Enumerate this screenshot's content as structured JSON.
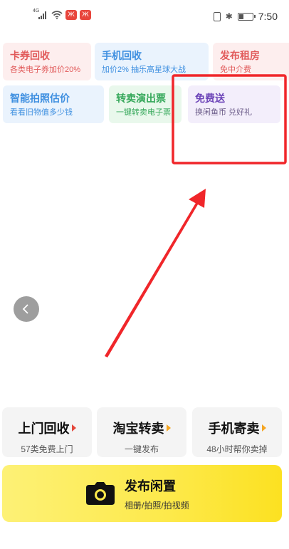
{
  "status_bar": {
    "network_label": "4G",
    "app_badge_1": "Ж",
    "app_badge_2": "Ж",
    "bluetooth_glyph": "✱",
    "time": "7:50"
  },
  "services": [
    {
      "title": "卡券回收",
      "subtitle": "各类电子券加价20%",
      "color": "red"
    },
    {
      "title": "手机回收",
      "subtitle": "加价2% 抽乐高星球大战",
      "color": "blue"
    },
    {
      "title": "发布租房",
      "subtitle": "免中介费",
      "color": "red"
    },
    {
      "title": "智能拍照估价",
      "subtitle": "看看旧物值多少钱",
      "color": "blue"
    },
    {
      "title": "转卖演出票",
      "subtitle": "一键转卖电子票",
      "color": "green"
    },
    {
      "title": "免费送",
      "subtitle": "换闲鱼币 兑好礼",
      "color": "purple"
    }
  ],
  "annotation": {
    "highlight_color": "#f0262a"
  },
  "quick_actions": [
    {
      "title": "上门回收",
      "subtitle": "57类免费上门"
    },
    {
      "title": "淘宝转卖",
      "subtitle": "一键发布"
    },
    {
      "title": "手机寄卖",
      "subtitle": "48小时帮你卖掉"
    }
  ],
  "publish": {
    "title": "发布闲置",
    "subtitle": "相册/拍照/拍视频",
    "icon": "camera-icon"
  },
  "colors": {
    "accent_yellow": "#fde94a",
    "arrow_red": "#f0262a"
  }
}
